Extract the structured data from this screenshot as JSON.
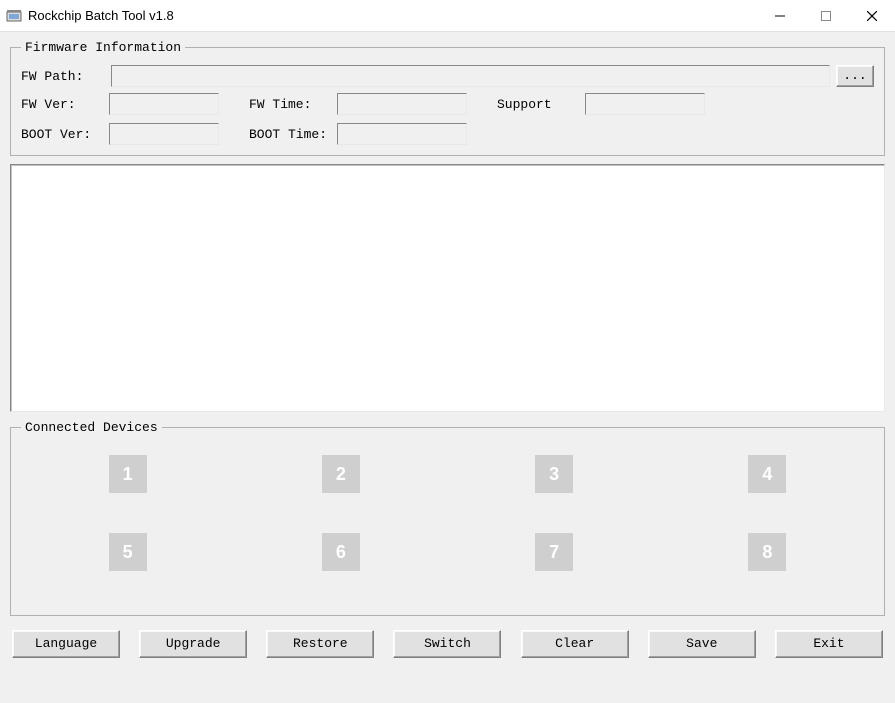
{
  "window": {
    "title": "Rockchip Batch Tool v1.8"
  },
  "firmware": {
    "legend": "Firmware Information",
    "fw_path_label": "FW Path:",
    "fw_path_value": "",
    "browse_label": "...",
    "fw_ver_label": "FW Ver:",
    "fw_ver_value": "",
    "fw_time_label": "FW Time:",
    "fw_time_value": "",
    "support_label": "Support",
    "support_value": "",
    "boot_ver_label": "BOOT Ver:",
    "boot_ver_value": "",
    "boot_time_label": "BOOT Time:",
    "boot_time_value": ""
  },
  "log": "",
  "devices": {
    "legend": "Connected Devices",
    "slots": [
      "1",
      "2",
      "3",
      "4",
      "5",
      "6",
      "7",
      "8"
    ]
  },
  "buttons": {
    "language": "Language",
    "upgrade": "Upgrade",
    "restore": "Restore",
    "switch": "Switch",
    "clear": "Clear",
    "save": "Save",
    "exit": "Exit"
  }
}
